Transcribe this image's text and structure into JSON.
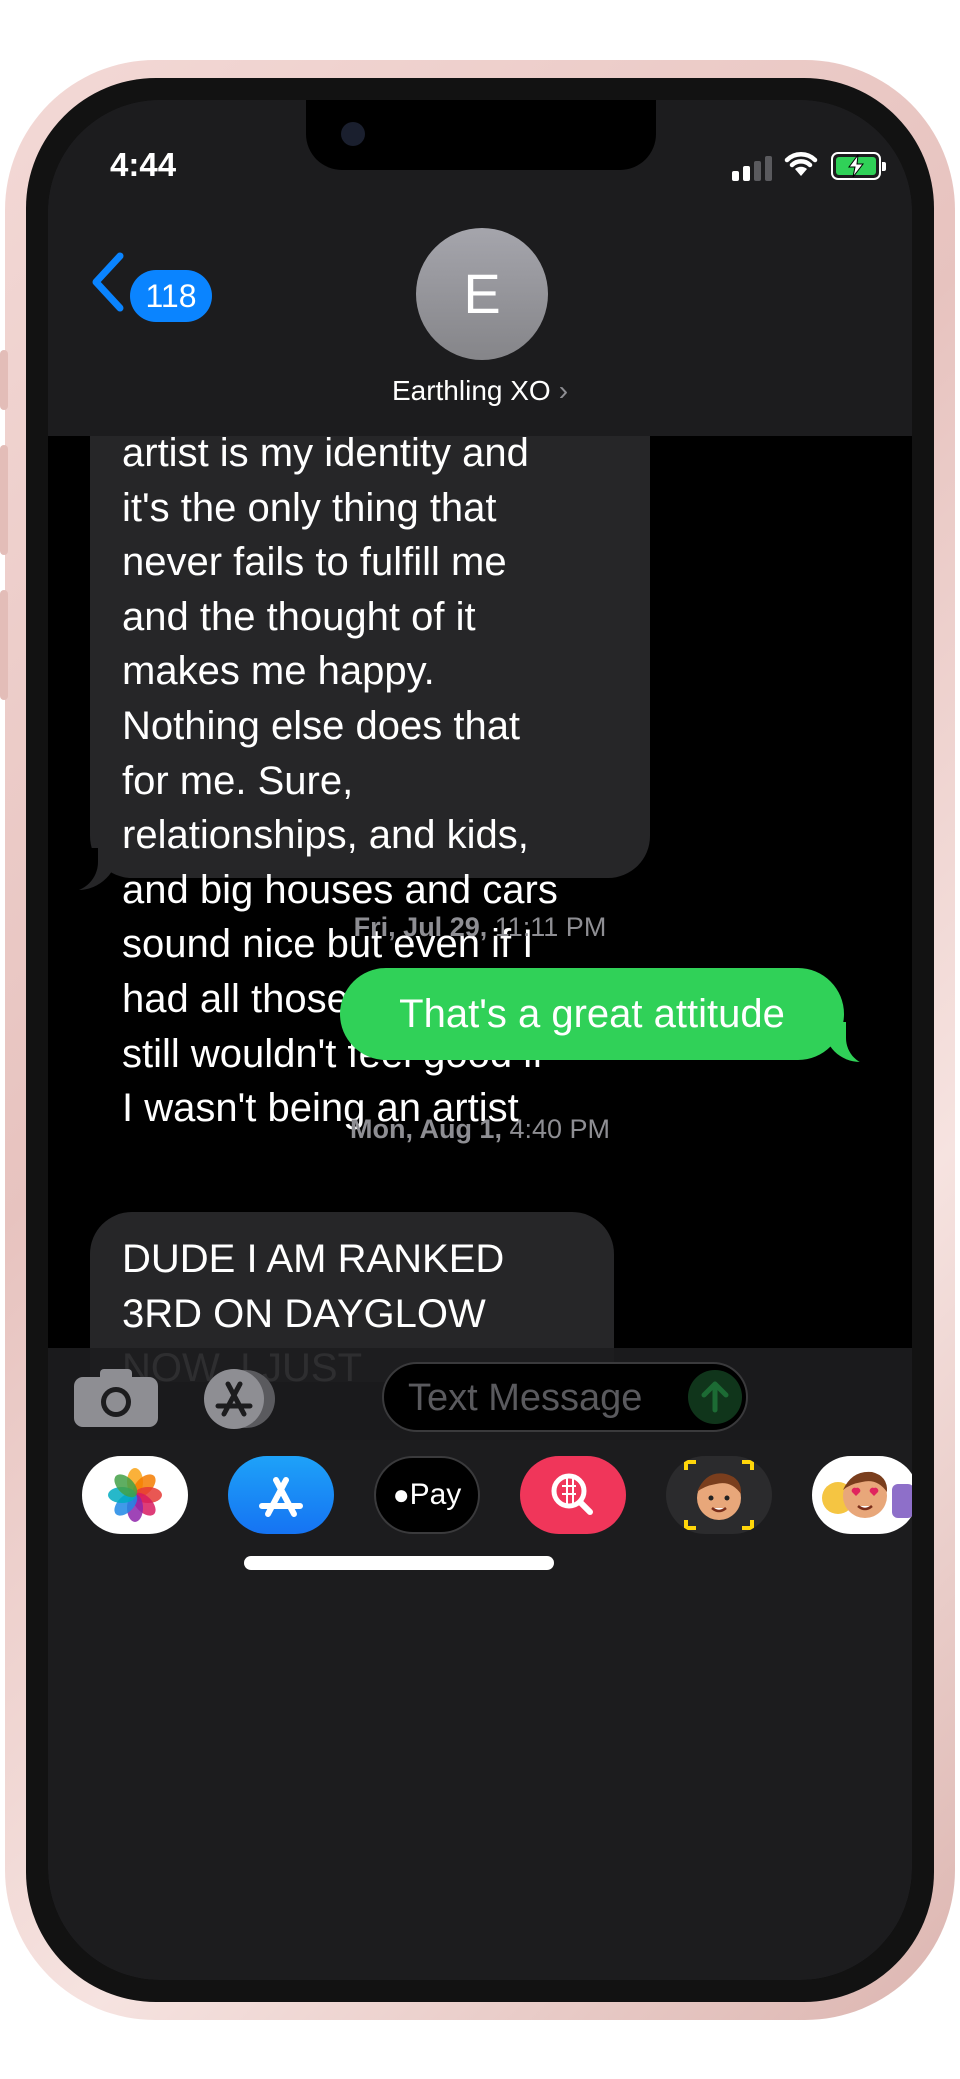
{
  "status_bar": {
    "time": "4:44"
  },
  "nav": {
    "back_count": "118"
  },
  "contact": {
    "initial": "E",
    "name": "Earthling XO",
    "chevron": "›"
  },
  "messages": {
    "incoming_1": "artist is my identity and\nit's the only thing that\nnever fails to fulfill me\nand the thought of it\nmakes me happy.\nNothing else does that\nfor me. Sure,\nrelationships, and kids,\nand big houses and cars\nsound nice but even if I\nhad all those things, I\nstill wouldn't feel good if\nI wasn't being an artist",
    "timestamp_1_day": "Fri, Jul 29,",
    "timestamp_1_time": "11:11 PM",
    "outgoing_1": "That's a great attitude",
    "timestamp_2_day": "Mon, Aug 1,",
    "timestamp_2_time": "4:40 PM",
    "incoming_2": "DUDE I AM RANKED\n3RD ON DAYGLOW\nNOW. I JUST"
  },
  "compose": {
    "placeholder": "Text Message"
  },
  "app_drawer": {
    "apple_pay_label": "Pay",
    "apps": [
      "photos-icon",
      "app-store-icon",
      "apple-pay-icon",
      "image-search-icon",
      "memoji-icon",
      "memoji-stickers-icon"
    ]
  },
  "colors": {
    "incoming_bubble": "#262628",
    "outgoing_bubble": "#30d158",
    "accent": "#0a84ff",
    "header_bg": "#1c1c1e",
    "timestamp": "#8e8e93"
  }
}
